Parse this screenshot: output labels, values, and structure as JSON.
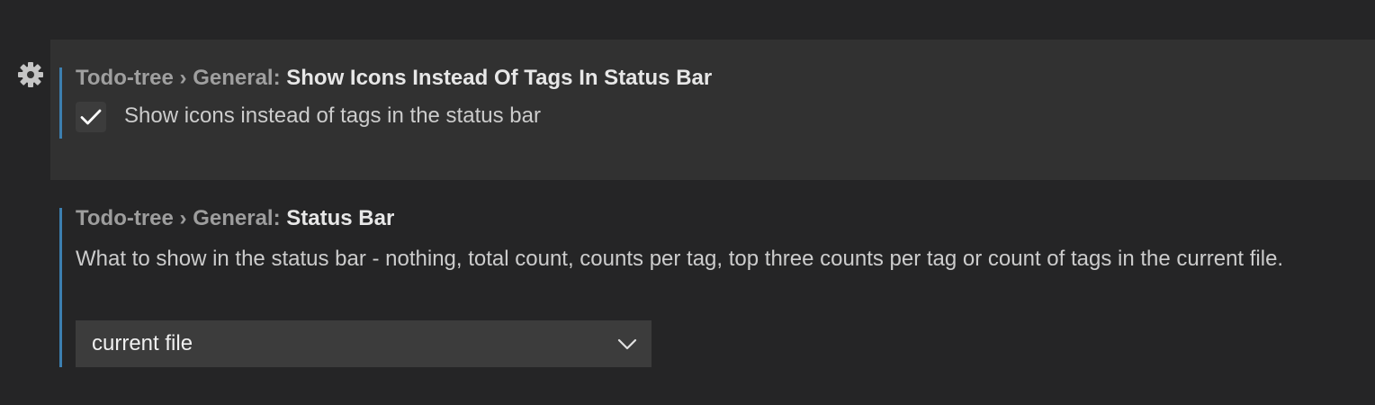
{
  "settings": [
    {
      "category": "Todo-tree › General: ",
      "name": "Show Icons Instead Of Tags In Status Bar",
      "checkbox_label": "Show icons instead of tags in the status bar",
      "checked": true
    },
    {
      "category": "Todo-tree › General: ",
      "name": "Status Bar",
      "description": "What to show in the status bar - nothing, total count, counts per tag, top three counts per tag or count of tags in the current file.",
      "selected_value": "current file"
    }
  ],
  "colors": {
    "background": "#252526",
    "focused_row": "#313131",
    "modified_indicator": "#3c7fb0",
    "input_background": "#3c3c3c"
  },
  "icons": {
    "gear": "gear-icon",
    "check": "check-icon",
    "dropdown": "chevron-down-icon"
  }
}
